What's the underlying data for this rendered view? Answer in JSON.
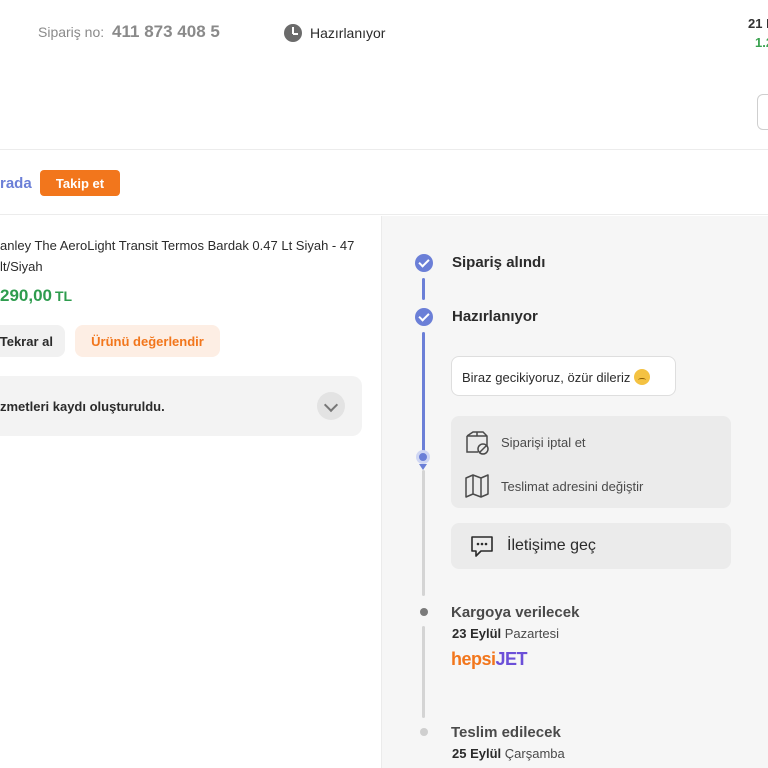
{
  "header": {
    "order_label": "Sipariş no:",
    "order_number": "411 873 408 5",
    "status": "Hazırlanıyor",
    "right_top": "21 I",
    "right_mid": "1.2"
  },
  "seller": {
    "name": "rada",
    "follow_label": "Takip et"
  },
  "product": {
    "title": "anley The AeroLight Transit Termos Bardak 0.47 Lt Siyah - 47 lt/Siyah",
    "price": "290,00",
    "currency": "TL",
    "rebuy_label": "Tekrar al",
    "rate_label": "Ürünü değerlendir",
    "service_text": "zmetleri kaydı oluşturuldu."
  },
  "timeline": {
    "step1": "Sipariş alındı",
    "step2": "Hazırlanıyor",
    "apology": "Biraz gecikiyoruz, özür dileriz",
    "cancel_label": "Siparişi iptal et",
    "address_label": "Teslimat adresini değiştir",
    "contact_label": "İletişime geç",
    "step3": "Kargoya verilecek",
    "step3_date": "23 Eylül",
    "step3_day": "Pazartesi",
    "carrier_hepsi": "hepsi",
    "carrier_jet": "JET",
    "step4": "Teslim edilecek",
    "step4_date": "25 Eylül",
    "step4_day": "Çarşamba"
  },
  "colors": {
    "accent": "#6b7fd7",
    "orange": "#f2761c",
    "green": "#2e9c4e"
  },
  "icons": {
    "status": "clock-icon",
    "cancel": "box-cancel-icon",
    "address": "map-icon",
    "contact": "chat-icon",
    "expand": "chevron-down-icon"
  }
}
